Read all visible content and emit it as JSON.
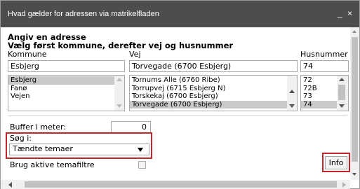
{
  "titlebar": {
    "title": "Hvad gælder for adressen via matrikelfladen",
    "minimize_glyph": "_",
    "close_glyph": "×"
  },
  "form": {
    "heading_1": "Angiv en adresse",
    "heading_2": "Vælg først kommune, derefter vej og husnummer",
    "kommune": {
      "label": "Kommune",
      "value": "Esbjerg",
      "options": [
        "Esbjerg",
        "Fanø",
        "Vejen"
      ],
      "selected_index": 0
    },
    "vej": {
      "label": "Vej",
      "value": "Torvegade (6700 Esbjerg)",
      "options": [
        "Tornums Alle (6760 Ribe)",
        "Torrupvej (6715 Esbjerg N)",
        "Torskekaj (6700 Esbjerg)",
        "Torvegade (6700 Esbjerg)"
      ],
      "selected_index": 3
    },
    "husnummer": {
      "label": "Husnummer",
      "value": "74",
      "options": [
        "72",
        "72B",
        "73",
        "74"
      ],
      "selected_index": 3
    },
    "buffer": {
      "label": "Buffer i meter:",
      "value": "0"
    },
    "soeg": {
      "label": "Søg i:",
      "selected": "Tændte temaer"
    },
    "filter": {
      "label": "Brug aktive temafiltre",
      "checked": false
    },
    "info_button": "Info"
  },
  "colors": {
    "titlebar": "#4d4d4d",
    "highlight_box": "#c0262c",
    "selected_row": "#c9c9c9"
  },
  "icons": {
    "minimize": "minimize-icon",
    "close": "close-icon",
    "scroll_up": "arrow-up-icon",
    "scroll_down": "arrow-down-icon",
    "scroll_left": "arrow-left-icon",
    "scroll_right": "arrow-right-icon",
    "dropdown": "chevron-down-icon"
  }
}
